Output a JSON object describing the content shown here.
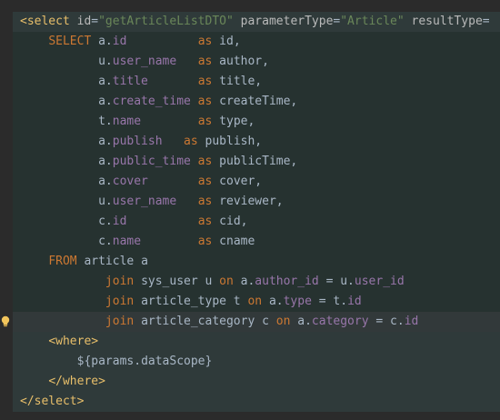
{
  "editor": {
    "lines": [
      {
        "indent": "",
        "tokens": [
          {
            "t": "<select ",
            "c": "tag"
          },
          {
            "t": "id",
            "c": "attr"
          },
          {
            "t": "=",
            "c": "plain"
          },
          {
            "t": "\"getArticleListDTO\"",
            "c": "str"
          },
          {
            "t": " ",
            "c": "plain"
          },
          {
            "t": "parameterType",
            "c": "attr"
          },
          {
            "t": "=",
            "c": "plain"
          },
          {
            "t": "\"Article\"",
            "c": "str"
          },
          {
            "t": " ",
            "c": "plain"
          },
          {
            "t": "resultType",
            "c": "attr"
          },
          {
            "t": "=",
            "c": "plain"
          }
        ]
      },
      {
        "indent": "    ",
        "tokens": [
          {
            "t": "SELECT ",
            "c": "kw"
          },
          {
            "t": "a.",
            "c": "plain"
          },
          {
            "t": "id",
            "c": "col"
          },
          {
            "t": "          ",
            "c": "plain"
          },
          {
            "t": "as",
            "c": "kw"
          },
          {
            "t": " id,",
            "c": "plain"
          }
        ]
      },
      {
        "indent": "           ",
        "tokens": [
          {
            "t": "u.",
            "c": "plain"
          },
          {
            "t": "user_name",
            "c": "col"
          },
          {
            "t": "   ",
            "c": "plain"
          },
          {
            "t": "as",
            "c": "kw"
          },
          {
            "t": " author,",
            "c": "plain"
          }
        ]
      },
      {
        "indent": "           ",
        "tokens": [
          {
            "t": "a.",
            "c": "plain"
          },
          {
            "t": "title",
            "c": "col"
          },
          {
            "t": "       ",
            "c": "plain"
          },
          {
            "t": "as",
            "c": "kw"
          },
          {
            "t": " title,",
            "c": "plain"
          }
        ]
      },
      {
        "indent": "           ",
        "tokens": [
          {
            "t": "a.",
            "c": "plain"
          },
          {
            "t": "create_time",
            "c": "col"
          },
          {
            "t": " ",
            "c": "plain"
          },
          {
            "t": "as",
            "c": "kw"
          },
          {
            "t": " createTime,",
            "c": "plain"
          }
        ]
      },
      {
        "indent": "           ",
        "tokens": [
          {
            "t": "t.",
            "c": "plain"
          },
          {
            "t": "name",
            "c": "col"
          },
          {
            "t": "        ",
            "c": "plain"
          },
          {
            "t": "as",
            "c": "kw"
          },
          {
            "t": " type,",
            "c": "plain"
          }
        ]
      },
      {
        "indent": "           ",
        "tokens": [
          {
            "t": "a.",
            "c": "plain"
          },
          {
            "t": "publish",
            "c": "col"
          },
          {
            "t": "   ",
            "c": "plain"
          },
          {
            "t": "as",
            "c": "kw"
          },
          {
            "t": " publish,",
            "c": "plain"
          }
        ]
      },
      {
        "indent": "           ",
        "tokens": [
          {
            "t": "a.",
            "c": "plain"
          },
          {
            "t": "public_time",
            "c": "col"
          },
          {
            "t": " ",
            "c": "plain"
          },
          {
            "t": "as",
            "c": "kw"
          },
          {
            "t": " publicTime,",
            "c": "plain"
          }
        ]
      },
      {
        "indent": "           ",
        "tokens": [
          {
            "t": "a.",
            "c": "plain"
          },
          {
            "t": "cover",
            "c": "col"
          },
          {
            "t": "       ",
            "c": "plain"
          },
          {
            "t": "as",
            "c": "kw"
          },
          {
            "t": " cover,",
            "c": "plain"
          }
        ]
      },
      {
        "indent": "           ",
        "tokens": [
          {
            "t": "u.",
            "c": "plain"
          },
          {
            "t": "user_name",
            "c": "col"
          },
          {
            "t": "   ",
            "c": "plain"
          },
          {
            "t": "as",
            "c": "kw"
          },
          {
            "t": " reviewer,",
            "c": "plain"
          }
        ]
      },
      {
        "indent": "           ",
        "tokens": [
          {
            "t": "c.",
            "c": "plain"
          },
          {
            "t": "id",
            "c": "col"
          },
          {
            "t": "          ",
            "c": "plain"
          },
          {
            "t": "as",
            "c": "kw"
          },
          {
            "t": " cid,",
            "c": "plain"
          }
        ]
      },
      {
        "indent": "           ",
        "tokens": [
          {
            "t": "c.",
            "c": "plain"
          },
          {
            "t": "name",
            "c": "col"
          },
          {
            "t": "        ",
            "c": "plain"
          },
          {
            "t": "as",
            "c": "kw"
          },
          {
            "t": " cname",
            "c": "plain"
          }
        ]
      },
      {
        "indent": "    ",
        "tokens": [
          {
            "t": "FROM ",
            "c": "kw"
          },
          {
            "t": "article a",
            "c": "plain"
          }
        ]
      },
      {
        "indent": "            ",
        "tokens": [
          {
            "t": "join ",
            "c": "kw"
          },
          {
            "t": "sys_user u ",
            "c": "plain"
          },
          {
            "t": "on ",
            "c": "kw"
          },
          {
            "t": "a.",
            "c": "plain"
          },
          {
            "t": "author_id",
            "c": "col"
          },
          {
            "t": " = u.",
            "c": "plain"
          },
          {
            "t": "user_id",
            "c": "col"
          }
        ]
      },
      {
        "indent": "            ",
        "tokens": [
          {
            "t": "join ",
            "c": "kw"
          },
          {
            "t": "article_type t ",
            "c": "plain"
          },
          {
            "t": "on ",
            "c": "kw"
          },
          {
            "t": "a.",
            "c": "plain"
          },
          {
            "t": "type",
            "c": "col"
          },
          {
            "t": " = t.",
            "c": "plain"
          },
          {
            "t": "id",
            "c": "col"
          }
        ]
      },
      {
        "indent": "            ",
        "tokens": [
          {
            "t": "join ",
            "c": "kw"
          },
          {
            "t": "article_category c ",
            "c": "plain"
          },
          {
            "t": "on ",
            "c": "kw"
          },
          {
            "t": "a.",
            "c": "plain"
          },
          {
            "t": "category",
            "c": "col"
          },
          {
            "t": " = c.",
            "c": "plain"
          },
          {
            "t": "id",
            "c": "col"
          }
        ]
      },
      {
        "indent": "    ",
        "tokens": [
          {
            "t": "<where>",
            "c": "tag"
          }
        ]
      },
      {
        "indent": "        ",
        "tokens": [
          {
            "t": "${params.dataScope}",
            "c": "plain"
          }
        ]
      },
      {
        "indent": "    ",
        "tokens": [
          {
            "t": "</where>",
            "c": "tag"
          }
        ]
      },
      {
        "indent": "",
        "tokens": [
          {
            "t": "</select>",
            "c": "tag"
          }
        ]
      }
    ]
  },
  "icons": {
    "intention_bulb": "lightbulb-icon"
  },
  "colors": {
    "background": "#2b2b2b",
    "tag": "#e8bf6a",
    "string": "#6a8759",
    "keyword": "#cc7832",
    "column": "#9876aa",
    "text": "#a9b7c6",
    "bulb": "#f2c55c"
  }
}
